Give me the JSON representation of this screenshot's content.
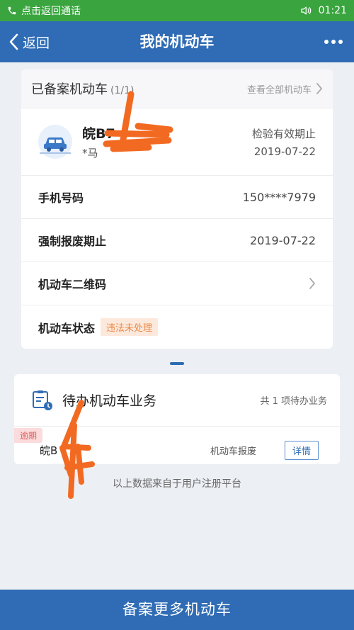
{
  "status_bar": {
    "call_text": "点击返回通话",
    "time": "01:21",
    "color": "#3aa53f"
  },
  "nav": {
    "back_label": "返回",
    "title": "我的机动车",
    "color": "#2f6cb5"
  },
  "registered": {
    "title": "已备案机动车",
    "count": "(1/1)",
    "view_all": "查看全部机动车",
    "vehicle": {
      "plate": "皖B7",
      "owner": "*马",
      "inspect_label": "检验有效期止",
      "inspect_date": "2019-07-22"
    },
    "rows": [
      {
        "label": "手机号码",
        "value": "150****7979"
      },
      {
        "label": "强制报废期止",
        "value": "2019-07-22"
      },
      {
        "label": "机动车二维码",
        "value": ""
      },
      {
        "label": "机动车状态",
        "value": "违法未处理"
      }
    ]
  },
  "pending": {
    "title": "待办机动车业务",
    "count_text": "共 1 项待办业务",
    "items": [
      {
        "tag": "逾期",
        "plate": "皖B",
        "type": "机动车报废",
        "detail_label": "详情"
      }
    ]
  },
  "source_note": "以上数据来自于用户注册平台",
  "bottom_button": "备案更多机动车",
  "colors": {
    "accent": "#2f6cb5",
    "badge_text": "#e98a4a",
    "badge_bg": "#fde9dc",
    "overdue": "#e15b5b",
    "scribble": "#f26a21"
  }
}
